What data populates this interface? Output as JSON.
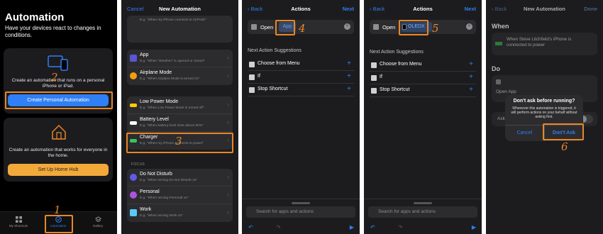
{
  "panel1": {
    "title": "Automation",
    "subtitle": "Have your devices react to changes in conditions.",
    "card_personal_desc": "Create an automation that runs on a personal iPhone or iPad.",
    "card_personal_btn": "Create Personal Automation",
    "card_home_desc": "Create an automation that works for everyone in the home.",
    "card_home_btn": "Set Up Home Hub",
    "tabs": [
      "My Shortcuts",
      "Automation",
      "Gallery"
    ],
    "step1": "1",
    "step2": "2"
  },
  "panel2": {
    "cancel": "Cancel",
    "title": "New Automation",
    "top_hint": "E.g. \"When my iPhone connects to AirPods\"",
    "group1": [
      {
        "title": "App",
        "sub": "E.g. \"When \"Weather\" is opened or closed\""
      },
      {
        "title": "Airplane Mode",
        "sub": "E.g. \"When Airplane Mode is turned on\""
      }
    ],
    "group2": [
      {
        "title": "Low Power Mode",
        "sub": "E.g. \"When Low Power Mode is turned off\""
      },
      {
        "title": "Battery Level",
        "sub": "E.g. \"When battery level rises above 50%\""
      },
      {
        "title": "Charger",
        "sub": "E.g. \"When my iPhone connects to power\""
      }
    ],
    "focus_header": "FOCUS",
    "group3": [
      {
        "title": "Do Not Disturb",
        "sub": "E.g. \"When turning Do Not Disturb on\""
      },
      {
        "title": "Personal",
        "sub": "E.g. \"When turning Personal on\""
      },
      {
        "title": "Work",
        "sub": "E.g. \"When turning Work on\""
      }
    ],
    "step3": "3"
  },
  "panel3": {
    "back": "Back",
    "title": "Actions",
    "next": "Next",
    "open_label": "Open",
    "app_placeholder": "App",
    "suggestions_header": "Next Action Suggestions",
    "suggestions": [
      "Choose from Menu",
      "If",
      "Stop Shortcut"
    ],
    "search_placeholder": "Search for apps and actions",
    "step4": "4"
  },
  "panel4": {
    "back": "Back",
    "title": "Actions",
    "next": "Next",
    "open_label": "Open",
    "app_value": "OLEDX",
    "suggestions_header": "Next Action Suggestions",
    "suggestions": [
      "Choose from Menu",
      "If",
      "Stop Shortcut"
    ],
    "search_placeholder": "Search for apps and actions",
    "step5": "5"
  },
  "panel5": {
    "back": "Back",
    "title": "New Automation",
    "done": "Done",
    "when_header": "When",
    "when_text": "When Steve Litchfield's iPhone is connected to power",
    "do_header": "Do",
    "open_app": "Open App",
    "ask_label": "Ask",
    "dialog_title": "Don't ask before running?",
    "dialog_body": "Whenever this automation is triggered, it will perform actions on your behalf without asking first.",
    "dialog_cancel": "Cancel",
    "dialog_confirm": "Don't Ask",
    "step6": "6"
  },
  "colors": {
    "accent": "#2f7ff5",
    "highlight": "#e8862a",
    "background": "#000000"
  }
}
